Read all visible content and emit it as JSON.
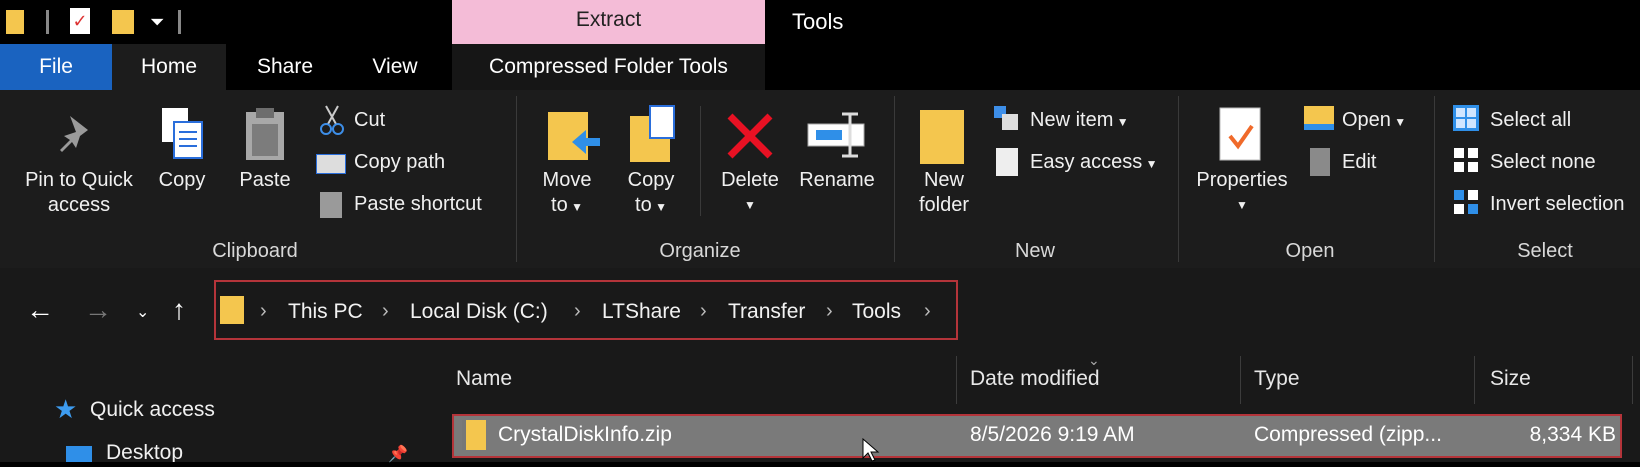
{
  "title_bar": {
    "context_tab": "Extract",
    "window_title": "Tools"
  },
  "tabs": {
    "file": "File",
    "home": "Home",
    "share": "Share",
    "view": "View",
    "compressed": "Compressed Folder Tools"
  },
  "clipboard": {
    "pin": [
      "Pin to Quick",
      "access"
    ],
    "copy": "Copy",
    "paste": "Paste",
    "cut": "Cut",
    "copy_path": "Copy path",
    "paste_shortcut": "Paste shortcut",
    "group": "Clipboard"
  },
  "organize": {
    "move_to": [
      "Move",
      "to"
    ],
    "copy_to": [
      "Copy",
      "to"
    ],
    "delete": "Delete",
    "rename": "Rename",
    "group": "Organize"
  },
  "new": {
    "new_folder": [
      "New",
      "folder"
    ],
    "new_item": "New item",
    "easy_access": "Easy access",
    "group": "New"
  },
  "open": {
    "properties": "Properties",
    "open": "Open",
    "edit": "Edit",
    "group": "Open"
  },
  "select": {
    "select_all": "Select all",
    "select_none": "Select none",
    "invert": "Invert selection",
    "group": "Select"
  },
  "breadcrumb": [
    "This PC",
    "Local Disk (C:)",
    "LTShare",
    "Transfer",
    "Tools"
  ],
  "columns": {
    "name": "Name",
    "date": "Date modified",
    "type": "Type",
    "size": "Size"
  },
  "navpane": {
    "quick_access": "Quick access",
    "desktop": "Desktop"
  },
  "files": [
    {
      "name": "CrystalDiskInfo.zip",
      "date": "8/5/2026 9:19 AM",
      "type": "Compressed (zipp...",
      "size": "8,334 KB"
    }
  ],
  "colors": {
    "accent": "#1a63c0",
    "context_tab": "#f4bcd7",
    "highlight_border": "#b4343a",
    "selected_row": "#7a7a7a"
  }
}
